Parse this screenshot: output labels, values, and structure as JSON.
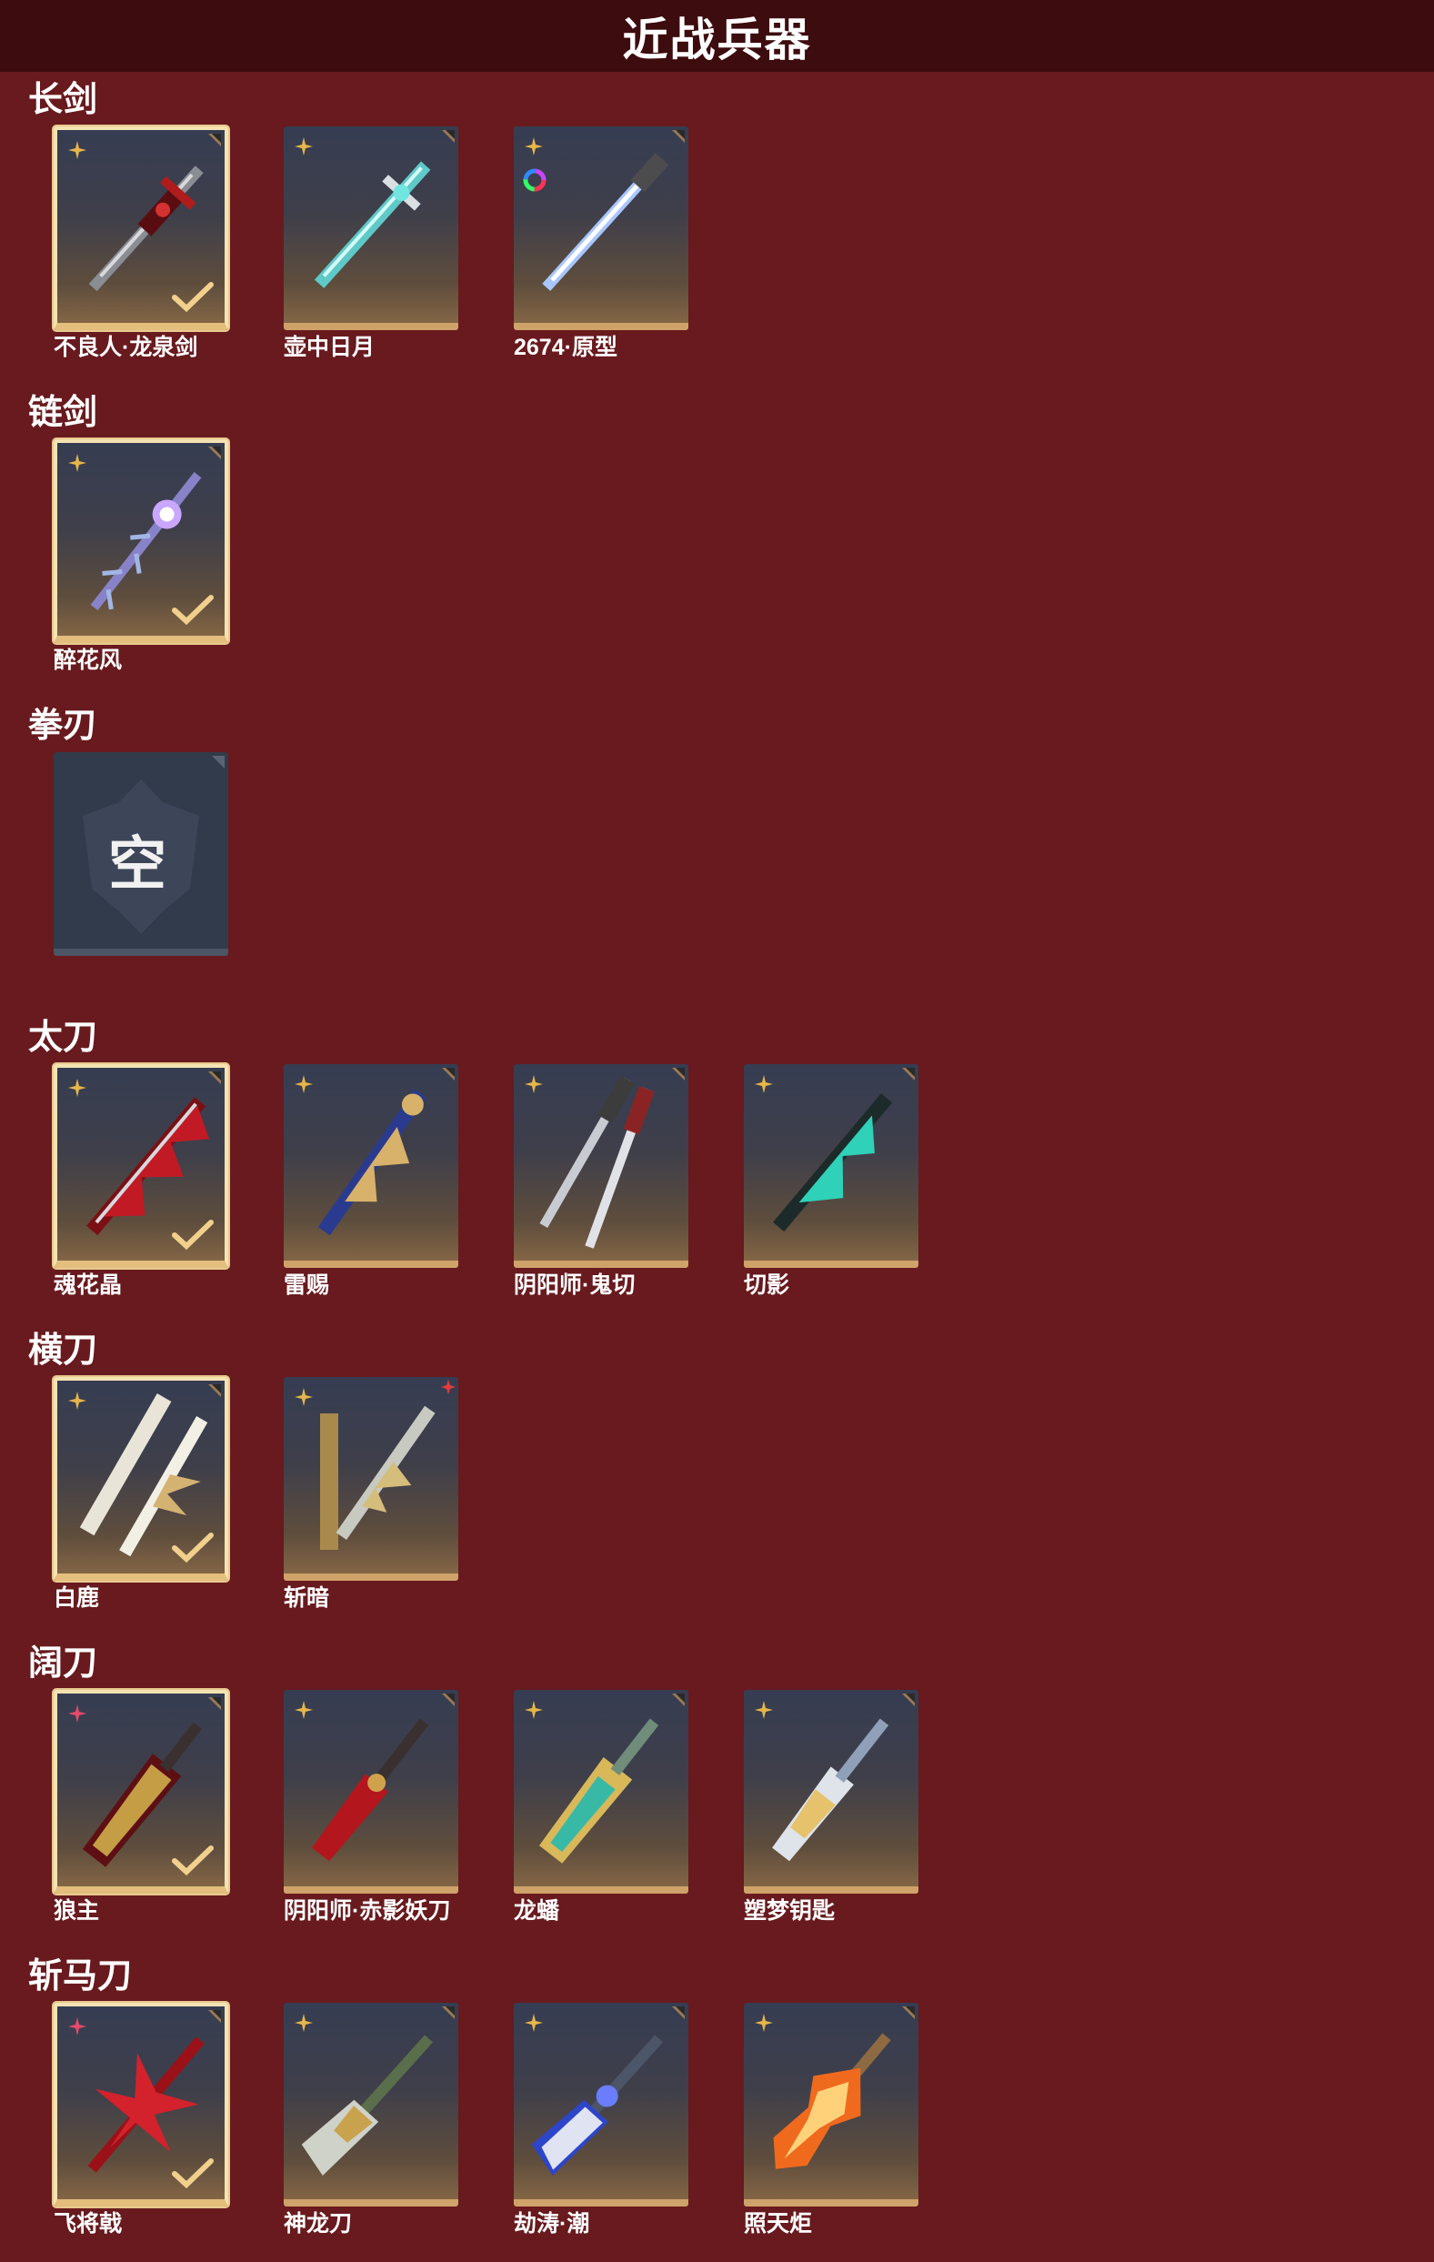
{
  "page": {
    "title": "近战兵器"
  },
  "sections": [
    {
      "title": "长剑",
      "items": [
        {
          "name": "不良人·龙泉剑",
          "selected": true,
          "badge": "gold-shuriken",
          "extra_badge": ""
        },
        {
          "name": "壶中日月",
          "selected": false,
          "badge": "gold-shuriken",
          "extra_badge": ""
        },
        {
          "name": "2674·原型",
          "selected": false,
          "badge": "gold-shuriken",
          "extra_badge": "rainbow-ring"
        }
      ]
    },
    {
      "title": "链剑",
      "items": [
        {
          "name": "醉花风",
          "selected": true,
          "badge": "gold-shuriken",
          "extra_badge": ""
        }
      ]
    },
    {
      "title": "拳刃",
      "items": [
        {
          "name": "",
          "selected": false,
          "empty": true,
          "empty_text": "空"
        }
      ]
    },
    {
      "title": "太刀",
      "items": [
        {
          "name": "魂花晶",
          "selected": true,
          "badge": "gold-shuriken",
          "extra_badge": ""
        },
        {
          "name": "雷赐",
          "selected": false,
          "badge": "gold-shuriken",
          "extra_badge": ""
        },
        {
          "name": "阴阳师·鬼切",
          "selected": false,
          "badge": "gold-shuriken",
          "extra_badge": ""
        },
        {
          "name": "切影",
          "selected": false,
          "badge": "gold-shuriken",
          "extra_badge": ""
        }
      ]
    },
    {
      "title": "横刀",
      "items": [
        {
          "name": "白鹿",
          "selected": true,
          "badge": "gold-shuriken",
          "extra_badge": ""
        },
        {
          "name": "斩暗",
          "selected": false,
          "badge": "gold-shuriken",
          "extra_badge": "",
          "red_corner": true
        }
      ]
    },
    {
      "title": "阔刀",
      "items": [
        {
          "name": "狼主",
          "selected": true,
          "badge": "red-shuriken",
          "extra_badge": ""
        },
        {
          "name": "阴阳师·赤影妖刀",
          "selected": false,
          "badge": "gold-shuriken",
          "extra_badge": ""
        },
        {
          "name": "龙蟠",
          "selected": false,
          "badge": "gold-shuriken",
          "extra_badge": ""
        },
        {
          "name": "塑梦钥匙",
          "selected": false,
          "badge": "gold-shuriken",
          "extra_badge": ""
        }
      ]
    },
    {
      "title": "斩马刀",
      "items": [
        {
          "name": "飞将戟",
          "selected": true,
          "badge": "red-shuriken",
          "extra_badge": ""
        },
        {
          "name": "神龙刀",
          "selected": false,
          "badge": "gold-shuriken",
          "extra_badge": ""
        },
        {
          "name": "劫涛·潮",
          "selected": false,
          "badge": "gold-shuriken",
          "extra_badge": ""
        },
        {
          "name": "照天炬",
          "selected": false,
          "badge": "gold-shuriken",
          "extra_badge": ""
        }
      ]
    }
  ],
  "colors": {
    "background": "#681a1e",
    "header": "#3d0c0f",
    "tile_gold_edge": "#cfa26a",
    "selected_border": "#f4e3b2"
  }
}
